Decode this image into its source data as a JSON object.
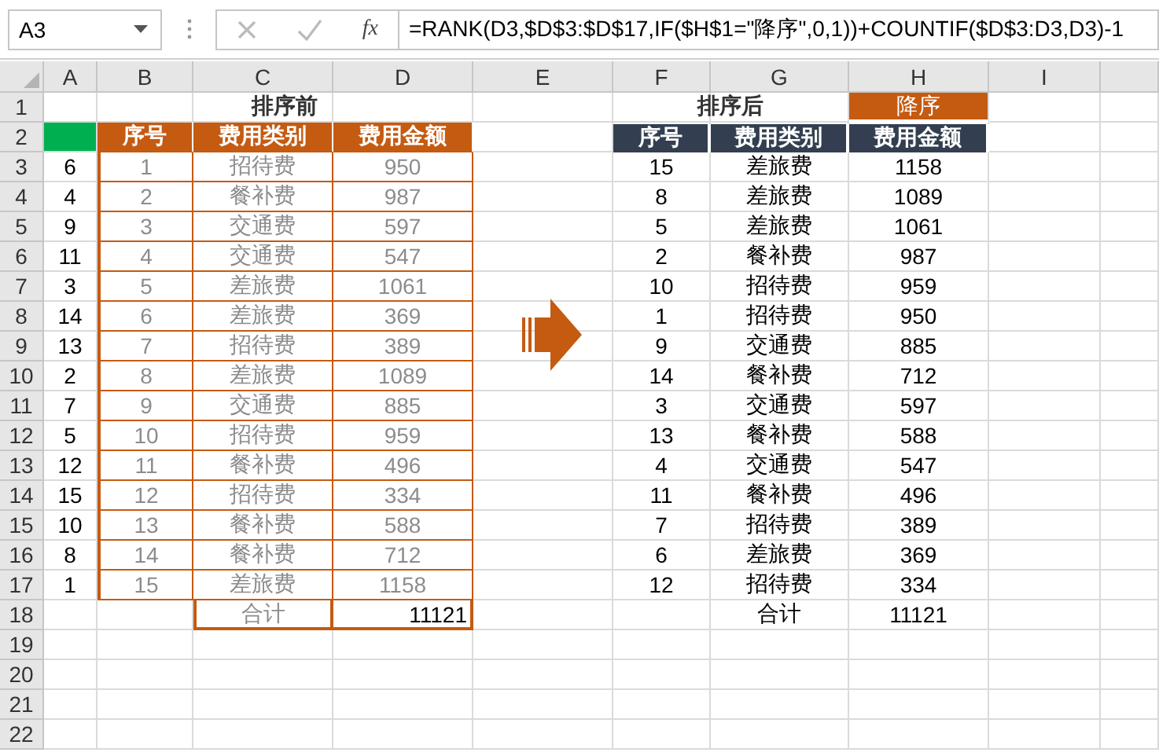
{
  "name_box": {
    "value": "A3"
  },
  "formula_bar": {
    "function_label": "fx",
    "formula": "=RANK(D3,$D$3:$D$17,IF($H$1=\"降序\",0,1))+COUNTIF($D$3:D3,D3)-1"
  },
  "columns": [
    "A",
    "B",
    "C",
    "D",
    "E",
    "F",
    "G",
    "H",
    "I"
  ],
  "rows": [
    "1",
    "2",
    "3",
    "4",
    "5",
    "6",
    "7",
    "8",
    "9",
    "10",
    "11",
    "12",
    "13",
    "14",
    "15",
    "16",
    "17",
    "18",
    "19",
    "20",
    "21",
    "22"
  ],
  "rank_column": [
    "6",
    "4",
    "9",
    "11",
    "3",
    "14",
    "13",
    "2",
    "7",
    "5",
    "12",
    "15",
    "10",
    "8",
    "1"
  ],
  "before": {
    "title": "排序前",
    "headers": [
      "序号",
      "费用类别",
      "费用金额"
    ],
    "rows": [
      {
        "no": "1",
        "category": "招待费",
        "amount": "950"
      },
      {
        "no": "2",
        "category": "餐补费",
        "amount": "987"
      },
      {
        "no": "3",
        "category": "交通费",
        "amount": "597"
      },
      {
        "no": "4",
        "category": "交通费",
        "amount": "547"
      },
      {
        "no": "5",
        "category": "差旅费",
        "amount": "1061"
      },
      {
        "no": "6",
        "category": "差旅费",
        "amount": "369"
      },
      {
        "no": "7",
        "category": "招待费",
        "amount": "389"
      },
      {
        "no": "8",
        "category": "差旅费",
        "amount": "1089"
      },
      {
        "no": "9",
        "category": "交通费",
        "amount": "885"
      },
      {
        "no": "10",
        "category": "招待费",
        "amount": "959"
      },
      {
        "no": "11",
        "category": "餐补费",
        "amount": "496"
      },
      {
        "no": "12",
        "category": "招待费",
        "amount": "334"
      },
      {
        "no": "13",
        "category": "餐补费",
        "amount": "588"
      },
      {
        "no": "14",
        "category": "餐补费",
        "amount": "712"
      },
      {
        "no": "15",
        "category": "差旅费",
        "amount": "1158"
      }
    ],
    "total_label": "合计",
    "total": "11121"
  },
  "sort_order": {
    "label": "降序"
  },
  "after": {
    "title": "排序后",
    "headers": [
      "序号",
      "费用类别",
      "费用金额"
    ],
    "rows": [
      {
        "no": "15",
        "category": "差旅费",
        "amount": "1158"
      },
      {
        "no": "8",
        "category": "差旅费",
        "amount": "1089"
      },
      {
        "no": "5",
        "category": "差旅费",
        "amount": "1061"
      },
      {
        "no": "2",
        "category": "餐补费",
        "amount": "987"
      },
      {
        "no": "10",
        "category": "招待费",
        "amount": "959"
      },
      {
        "no": "1",
        "category": "招待费",
        "amount": "950"
      },
      {
        "no": "9",
        "category": "交通费",
        "amount": "885"
      },
      {
        "no": "14",
        "category": "餐补费",
        "amount": "712"
      },
      {
        "no": "3",
        "category": "交通费",
        "amount": "597"
      },
      {
        "no": "13",
        "category": "餐补费",
        "amount": "588"
      },
      {
        "no": "4",
        "category": "交通费",
        "amount": "547"
      },
      {
        "no": "11",
        "category": "餐补费",
        "amount": "496"
      },
      {
        "no": "7",
        "category": "招待费",
        "amount": "389"
      },
      {
        "no": "6",
        "category": "差旅费",
        "amount": "369"
      },
      {
        "no": "12",
        "category": "招待费",
        "amount": "334"
      }
    ],
    "total_label": "合计",
    "total": "11121"
  }
}
